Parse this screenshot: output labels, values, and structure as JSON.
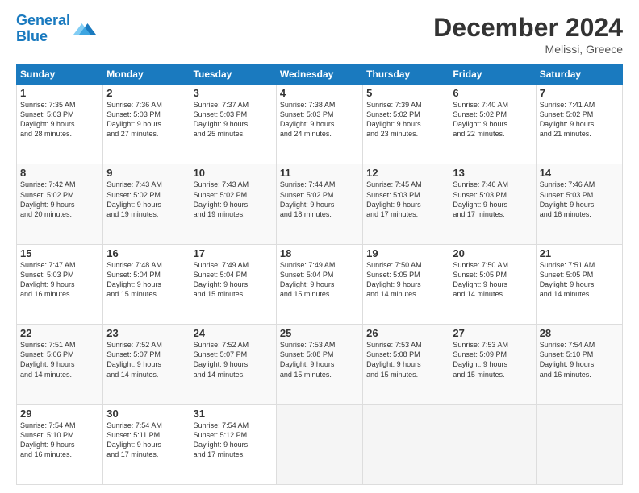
{
  "header": {
    "logo_line1": "General",
    "logo_line2": "Blue",
    "month_title": "December 2024",
    "location": "Melissi, Greece"
  },
  "columns": [
    "Sunday",
    "Monday",
    "Tuesday",
    "Wednesday",
    "Thursday",
    "Friday",
    "Saturday"
  ],
  "weeks": [
    [
      {
        "day": "1",
        "lines": [
          "Sunrise: 7:35 AM",
          "Sunset: 5:03 PM",
          "Daylight: 9 hours",
          "and 28 minutes."
        ]
      },
      {
        "day": "2",
        "lines": [
          "Sunrise: 7:36 AM",
          "Sunset: 5:03 PM",
          "Daylight: 9 hours",
          "and 27 minutes."
        ]
      },
      {
        "day": "3",
        "lines": [
          "Sunrise: 7:37 AM",
          "Sunset: 5:03 PM",
          "Daylight: 9 hours",
          "and 25 minutes."
        ]
      },
      {
        "day": "4",
        "lines": [
          "Sunrise: 7:38 AM",
          "Sunset: 5:03 PM",
          "Daylight: 9 hours",
          "and 24 minutes."
        ]
      },
      {
        "day": "5",
        "lines": [
          "Sunrise: 7:39 AM",
          "Sunset: 5:02 PM",
          "Daylight: 9 hours",
          "and 23 minutes."
        ]
      },
      {
        "day": "6",
        "lines": [
          "Sunrise: 7:40 AM",
          "Sunset: 5:02 PM",
          "Daylight: 9 hours",
          "and 22 minutes."
        ]
      },
      {
        "day": "7",
        "lines": [
          "Sunrise: 7:41 AM",
          "Sunset: 5:02 PM",
          "Daylight: 9 hours",
          "and 21 minutes."
        ]
      }
    ],
    [
      {
        "day": "8",
        "lines": [
          "Sunrise: 7:42 AM",
          "Sunset: 5:02 PM",
          "Daylight: 9 hours",
          "and 20 minutes."
        ]
      },
      {
        "day": "9",
        "lines": [
          "Sunrise: 7:43 AM",
          "Sunset: 5:02 PM",
          "Daylight: 9 hours",
          "and 19 minutes."
        ]
      },
      {
        "day": "10",
        "lines": [
          "Sunrise: 7:43 AM",
          "Sunset: 5:02 PM",
          "Daylight: 9 hours",
          "and 19 minutes."
        ]
      },
      {
        "day": "11",
        "lines": [
          "Sunrise: 7:44 AM",
          "Sunset: 5:02 PM",
          "Daylight: 9 hours",
          "and 18 minutes."
        ]
      },
      {
        "day": "12",
        "lines": [
          "Sunrise: 7:45 AM",
          "Sunset: 5:03 PM",
          "Daylight: 9 hours",
          "and 17 minutes."
        ]
      },
      {
        "day": "13",
        "lines": [
          "Sunrise: 7:46 AM",
          "Sunset: 5:03 PM",
          "Daylight: 9 hours",
          "and 17 minutes."
        ]
      },
      {
        "day": "14",
        "lines": [
          "Sunrise: 7:46 AM",
          "Sunset: 5:03 PM",
          "Daylight: 9 hours",
          "and 16 minutes."
        ]
      }
    ],
    [
      {
        "day": "15",
        "lines": [
          "Sunrise: 7:47 AM",
          "Sunset: 5:03 PM",
          "Daylight: 9 hours",
          "and 16 minutes."
        ]
      },
      {
        "day": "16",
        "lines": [
          "Sunrise: 7:48 AM",
          "Sunset: 5:04 PM",
          "Daylight: 9 hours",
          "and 15 minutes."
        ]
      },
      {
        "day": "17",
        "lines": [
          "Sunrise: 7:49 AM",
          "Sunset: 5:04 PM",
          "Daylight: 9 hours",
          "and 15 minutes."
        ]
      },
      {
        "day": "18",
        "lines": [
          "Sunrise: 7:49 AM",
          "Sunset: 5:04 PM",
          "Daylight: 9 hours",
          "and 15 minutes."
        ]
      },
      {
        "day": "19",
        "lines": [
          "Sunrise: 7:50 AM",
          "Sunset: 5:05 PM",
          "Daylight: 9 hours",
          "and 14 minutes."
        ]
      },
      {
        "day": "20",
        "lines": [
          "Sunrise: 7:50 AM",
          "Sunset: 5:05 PM",
          "Daylight: 9 hours",
          "and 14 minutes."
        ]
      },
      {
        "day": "21",
        "lines": [
          "Sunrise: 7:51 AM",
          "Sunset: 5:05 PM",
          "Daylight: 9 hours",
          "and 14 minutes."
        ]
      }
    ],
    [
      {
        "day": "22",
        "lines": [
          "Sunrise: 7:51 AM",
          "Sunset: 5:06 PM",
          "Daylight: 9 hours",
          "and 14 minutes."
        ]
      },
      {
        "day": "23",
        "lines": [
          "Sunrise: 7:52 AM",
          "Sunset: 5:07 PM",
          "Daylight: 9 hours",
          "and 14 minutes."
        ]
      },
      {
        "day": "24",
        "lines": [
          "Sunrise: 7:52 AM",
          "Sunset: 5:07 PM",
          "Daylight: 9 hours",
          "and 14 minutes."
        ]
      },
      {
        "day": "25",
        "lines": [
          "Sunrise: 7:53 AM",
          "Sunset: 5:08 PM",
          "Daylight: 9 hours",
          "and 15 minutes."
        ]
      },
      {
        "day": "26",
        "lines": [
          "Sunrise: 7:53 AM",
          "Sunset: 5:08 PM",
          "Daylight: 9 hours",
          "and 15 minutes."
        ]
      },
      {
        "day": "27",
        "lines": [
          "Sunrise: 7:53 AM",
          "Sunset: 5:09 PM",
          "Daylight: 9 hours",
          "and 15 minutes."
        ]
      },
      {
        "day": "28",
        "lines": [
          "Sunrise: 7:54 AM",
          "Sunset: 5:10 PM",
          "Daylight: 9 hours",
          "and 16 minutes."
        ]
      }
    ],
    [
      {
        "day": "29",
        "lines": [
          "Sunrise: 7:54 AM",
          "Sunset: 5:10 PM",
          "Daylight: 9 hours",
          "and 16 minutes."
        ]
      },
      {
        "day": "30",
        "lines": [
          "Sunrise: 7:54 AM",
          "Sunset: 5:11 PM",
          "Daylight: 9 hours",
          "and 17 minutes."
        ]
      },
      {
        "day": "31",
        "lines": [
          "Sunrise: 7:54 AM",
          "Sunset: 5:12 PM",
          "Daylight: 9 hours",
          "and 17 minutes."
        ]
      },
      null,
      null,
      null,
      null
    ]
  ]
}
